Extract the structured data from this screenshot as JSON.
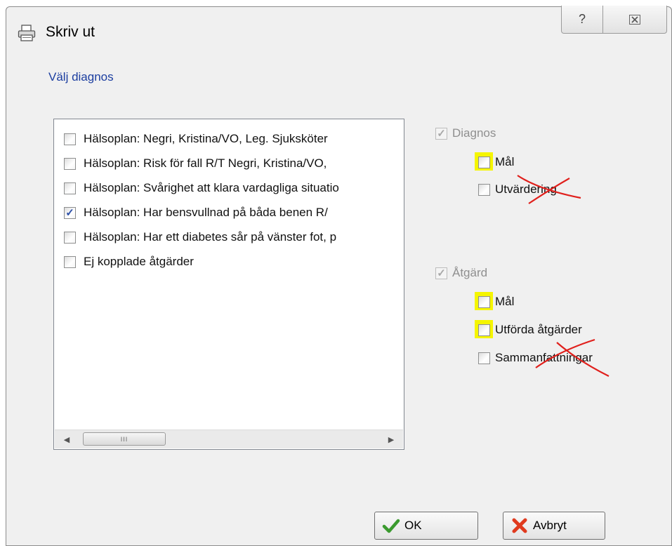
{
  "window": {
    "title": "Skriv ut",
    "help_glyph": "?",
    "close_glyph": "☒"
  },
  "section_label": "Välj diagnos",
  "list": {
    "items": [
      {
        "label": "Hälsoplan:   Negri, Kristina/VO, Leg. Sjuksköter",
        "checked": false
      },
      {
        "label": "Hälsoplan: Risk för fall R/T  Negri, Kristina/VO,",
        "checked": false
      },
      {
        "label": "Hälsoplan: Svårighet att klara vardagliga situatio",
        "checked": false
      },
      {
        "label": "Hälsoplan: Har bensvullnad på båda benen R/",
        "checked": true
      },
      {
        "label": "Hälsoplan: Har ett diabetes sår på vänster fot, p",
        "checked": false
      },
      {
        "label": "Ej kopplade åtgärder",
        "checked": false
      }
    ],
    "scroll_grip": "III",
    "scroll_left": "◀",
    "scroll_right": "▶"
  },
  "diagnos": {
    "label": "Diagnos",
    "checked": true,
    "enabled": false,
    "options": [
      {
        "label": "Mål",
        "checked": false,
        "highlighted": true,
        "crossed_out": false
      },
      {
        "label": "Utvärdering",
        "checked": false,
        "highlighted": false,
        "crossed_out": true
      }
    ]
  },
  "atgard": {
    "label": "Åtgärd",
    "checked": true,
    "enabled": false,
    "options": [
      {
        "label": "Mål",
        "checked": false,
        "highlighted": true,
        "crossed_out": false
      },
      {
        "label": "Utförda åtgärder",
        "checked": false,
        "highlighted": true,
        "crossed_out": false
      },
      {
        "label": "Sammanfattningar",
        "checked": false,
        "highlighted": false,
        "crossed_out": true
      }
    ]
  },
  "buttons": {
    "ok": "OK",
    "cancel": "Avbryt"
  },
  "colors": {
    "highlight": "#f5f500",
    "cross": "#e0201c",
    "link_label": "#1c3ea0",
    "ok_check": "#3a9a2e",
    "cancel_x": "#e03a1e"
  },
  "icons": {
    "title": "printer-icon",
    "ok": "green-checkmark-icon",
    "cancel": "red-x-icon"
  }
}
